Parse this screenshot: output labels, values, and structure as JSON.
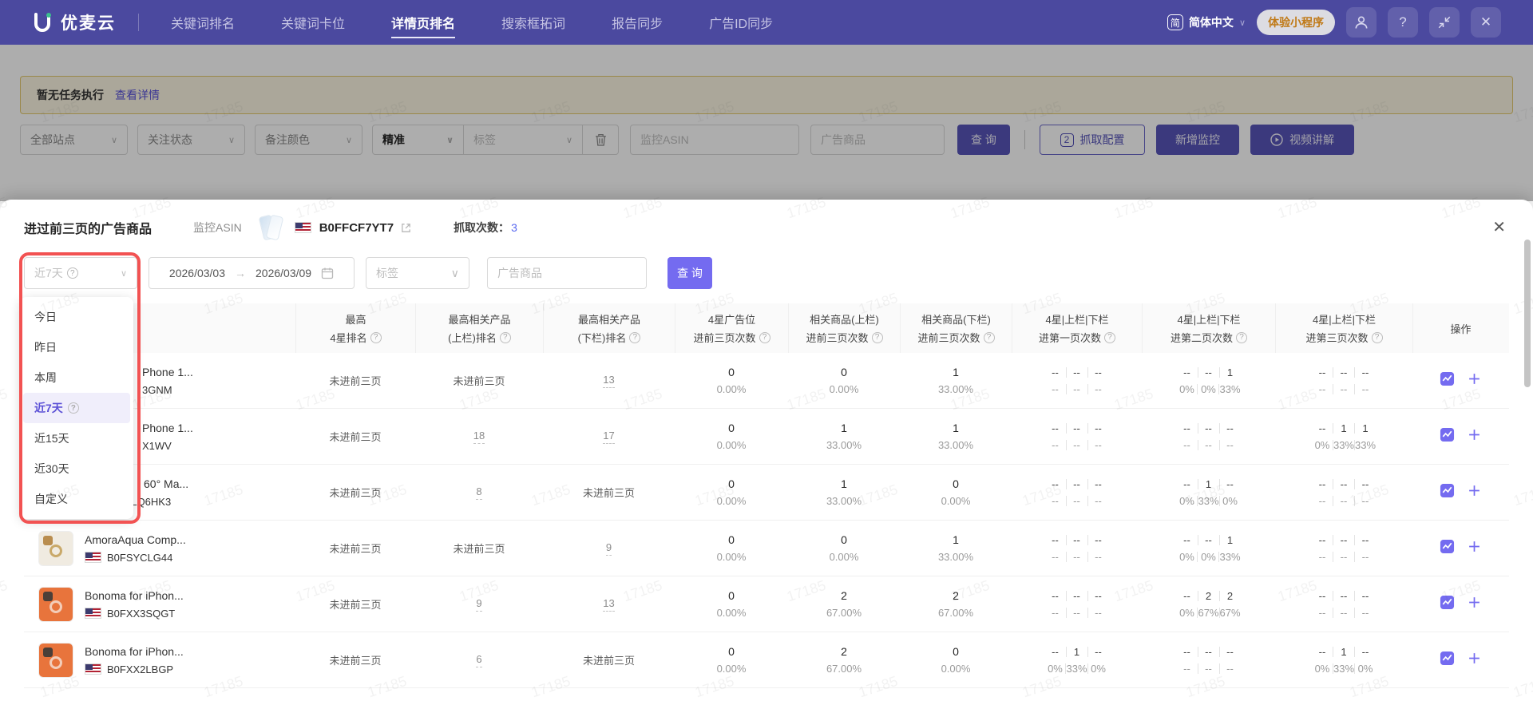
{
  "watermark": "17185",
  "nav": {
    "brand": "优麦云",
    "items": [
      {
        "label": "关键词排名",
        "active": false
      },
      {
        "label": "关键词卡位",
        "active": false
      },
      {
        "label": "详情页排名",
        "active": true
      },
      {
        "label": "搜索框拓词",
        "active": false
      },
      {
        "label": "报告同步",
        "active": false
      },
      {
        "label": "广告ID同步",
        "active": false
      }
    ],
    "lang_badge": "简",
    "language": "简体中文",
    "mini_program": "体验小程序"
  },
  "notice": {
    "text": "暂无任务执行",
    "link": "查看详情"
  },
  "filters": {
    "site": "全部站点",
    "follow": "关注状态",
    "note_color": "备注颜色",
    "match": "精准",
    "tag": "标签",
    "asin_placeholder": "监控ASIN",
    "ad_product_placeholder": "广告商品",
    "query": "查 询",
    "config_badge": "2",
    "config": "抓取配置",
    "add": "新增监控",
    "video": "视频讲解"
  },
  "modal": {
    "title": "进过前三页的广告商品",
    "asin_label": "监控ASIN",
    "asin": "B0FFCF7YT7",
    "crawl_label": "抓取次数：",
    "crawl_count": "3",
    "filter": {
      "range_selected": "近7天",
      "date_from": "2026/03/03",
      "date_to": "2026/03/09",
      "tag_placeholder": "标签",
      "ad_placeholder": "广告商品",
      "query": "查 询",
      "range_options": [
        {
          "label": "今日",
          "selected": false,
          "info": false
        },
        {
          "label": "昨日",
          "selected": false,
          "info": false
        },
        {
          "label": "本周",
          "selected": false,
          "info": false
        },
        {
          "label": "近7天",
          "selected": true,
          "info": true
        },
        {
          "label": "近15天",
          "selected": false,
          "info": false
        },
        {
          "label": "近30天",
          "selected": false,
          "info": false
        },
        {
          "label": "自定义",
          "selected": false,
          "info": false
        }
      ]
    },
    "table": {
      "headers": [
        {
          "line1": "",
          "line2": "",
          "info": false
        },
        {
          "line1": "最高",
          "line2": "4星排名",
          "info": true
        },
        {
          "line1": "最高相关产品",
          "line2": "(上栏)排名",
          "info": true
        },
        {
          "line1": "最高相关产品",
          "line2": "(下栏)排名",
          "info": true
        },
        {
          "line1": "4星广告位",
          "line2": "进前三页次数",
          "info": true
        },
        {
          "line1": "相关商品(上栏)",
          "line2": "进前三页次数",
          "info": true
        },
        {
          "line1": "相关商品(下栏)",
          "line2": "进前三页次数",
          "info": true
        },
        {
          "line1": "4星|上栏|下栏",
          "line2": "进第一页次数",
          "info": true
        },
        {
          "line1": "4星|上栏|下栏",
          "line2": "进第二页次数",
          "info": true
        },
        {
          "line1": "4星|上栏|下栏",
          "line2": "进第三页次数",
          "info": true
        },
        {
          "line1": "操作",
          "line2": "",
          "info": false
        }
      ],
      "rows": [
        {
          "name": "Phone 1...",
          "asin": "3GNM",
          "flag": false,
          "image": null,
          "name_indent": "a",
          "asin_indent": "a",
          "rank_cells": [
            {
              "type": "text",
              "value": "未进前三页"
            },
            {
              "type": "text",
              "value": "未进前三页"
            },
            {
              "type": "link",
              "value": "13"
            }
          ],
          "count_cells": [
            {
              "num": "0",
              "pct": "0.00%"
            },
            {
              "num": "0",
              "pct": "0.00%"
            },
            {
              "num": "1",
              "pct": "33.00%"
            }
          ],
          "page_cells": [
            {
              "top": [
                "--",
                "--",
                "--"
              ],
              "bottom": [
                "--",
                "--",
                "--"
              ]
            },
            {
              "top": [
                "--",
                "--",
                "1"
              ],
              "bottom": [
                "0%",
                "0%",
                "33%"
              ]
            },
            {
              "top": [
                "--",
                "--",
                "--"
              ],
              "bottom": [
                "--",
                "--",
                "--"
              ]
            }
          ]
        },
        {
          "name": "Phone 1...",
          "asin": "X1WV",
          "flag": false,
          "image": null,
          "name_indent": "a",
          "asin_indent": "a",
          "rank_cells": [
            {
              "type": "text",
              "value": "未进前三页"
            },
            {
              "type": "link",
              "value": "18"
            },
            {
              "type": "link",
              "value": "17"
            }
          ],
          "count_cells": [
            {
              "num": "0",
              "pct": "0.00%"
            },
            {
              "num": "1",
              "pct": "33.00%"
            },
            {
              "num": "1",
              "pct": "33.00%"
            }
          ],
          "page_cells": [
            {
              "top": [
                "--",
                "--",
                "--"
              ],
              "bottom": [
                "--",
                "--",
                "--"
              ]
            },
            {
              "top": [
                "--",
                "--",
                "--"
              ],
              "bottom": [
                "--",
                "--",
                "--"
              ]
            },
            {
              "top": [
                "--",
                "1",
                "1"
              ],
              "bottom": [
                "0%",
                "33%",
                "33%"
              ]
            }
          ]
        },
        {
          "name": "60° Ma...",
          "asin": "B0FJLQ6HK3",
          "flag": true,
          "image": {
            "body": "#e4e4e4",
            "ring": "#d0d0d0",
            "camera": "#c4c4c4"
          },
          "name_indent": "b",
          "asin_indent": null,
          "rank_cells": [
            {
              "type": "text",
              "value": "未进前三页"
            },
            {
              "type": "link",
              "value": "8"
            },
            {
              "type": "text",
              "value": "未进前三页"
            }
          ],
          "count_cells": [
            {
              "num": "0",
              "pct": "0.00%"
            },
            {
              "num": "1",
              "pct": "33.00%"
            },
            {
              "num": "0",
              "pct": "0.00%"
            }
          ],
          "page_cells": [
            {
              "top": [
                "--",
                "--",
                "--"
              ],
              "bottom": [
                "--",
                "--",
                "--"
              ]
            },
            {
              "top": [
                "--",
                "1",
                "--"
              ],
              "bottom": [
                "0%",
                "33%",
                "0%"
              ]
            },
            {
              "top": [
                "--",
                "--",
                "--"
              ],
              "bottom": [
                "--",
                "--",
                "--"
              ]
            }
          ]
        },
        {
          "name": "AmoraAqua Comp...",
          "asin": "B0FSYCLG44",
          "flag": true,
          "image": {
            "body": "#f0ebe1",
            "ring": "#c9a96a",
            "camera": "#b98d4f"
          },
          "name_indent": null,
          "asin_indent": null,
          "rank_cells": [
            {
              "type": "text",
              "value": "未进前三页"
            },
            {
              "type": "text",
              "value": "未进前三页"
            },
            {
              "type": "link",
              "value": "9"
            }
          ],
          "count_cells": [
            {
              "num": "0",
              "pct": "0.00%"
            },
            {
              "num": "0",
              "pct": "0.00%"
            },
            {
              "num": "1",
              "pct": "33.00%"
            }
          ],
          "page_cells": [
            {
              "top": [
                "--",
                "--",
                "--"
              ],
              "bottom": [
                "--",
                "--",
                "--"
              ]
            },
            {
              "top": [
                "--",
                "--",
                "1"
              ],
              "bottom": [
                "0%",
                "0%",
                "33%"
              ]
            },
            {
              "top": [
                "--",
                "--",
                "--"
              ],
              "bottom": [
                "--",
                "--",
                "--"
              ]
            }
          ]
        },
        {
          "name": "Bonoma for iPhon...",
          "asin": "B0FXX3SQGT",
          "flag": true,
          "image": {
            "body": "#e8743c",
            "ring": "#f3cdb9",
            "camera": "#4a3f38"
          },
          "name_indent": null,
          "asin_indent": null,
          "rank_cells": [
            {
              "type": "text",
              "value": "未进前三页"
            },
            {
              "type": "link",
              "value": "9"
            },
            {
              "type": "link",
              "value": "13"
            }
          ],
          "count_cells": [
            {
              "num": "0",
              "pct": "0.00%"
            },
            {
              "num": "2",
              "pct": "67.00%"
            },
            {
              "num": "2",
              "pct": "67.00%"
            }
          ],
          "page_cells": [
            {
              "top": [
                "--",
                "--",
                "--"
              ],
              "bottom": [
                "--",
                "--",
                "--"
              ]
            },
            {
              "top": [
                "--",
                "2",
                "2"
              ],
              "bottom": [
                "0%",
                "67%",
                "67%"
              ]
            },
            {
              "top": [
                "--",
                "--",
                "--"
              ],
              "bottom": [
                "--",
                "--",
                "--"
              ]
            }
          ]
        },
        {
          "name": "Bonoma for iPhon...",
          "asin": "B0FXX2LBGP",
          "flag": true,
          "image": {
            "body": "#e8743c",
            "ring": "#f3cdb9",
            "camera": "#4a3f38"
          },
          "name_indent": null,
          "asin_indent": null,
          "rank_cells": [
            {
              "type": "text",
              "value": "未进前三页"
            },
            {
              "type": "link",
              "value": "6"
            },
            {
              "type": "text",
              "value": "未进前三页"
            }
          ],
          "count_cells": [
            {
              "num": "0",
              "pct": "0.00%"
            },
            {
              "num": "2",
              "pct": "67.00%"
            },
            {
              "num": "0",
              "pct": "0.00%"
            }
          ],
          "page_cells": [
            {
              "top": [
                "--",
                "1",
                "--"
              ],
              "bottom": [
                "0%",
                "33%",
                "0%"
              ]
            },
            {
              "top": [
                "--",
                "--",
                "--"
              ],
              "bottom": [
                "--",
                "--",
                "--"
              ]
            },
            {
              "top": [
                "--",
                "1",
                "--"
              ],
              "bottom": [
                "0%",
                "33%",
                "0%"
              ]
            }
          ]
        }
      ]
    }
  }
}
